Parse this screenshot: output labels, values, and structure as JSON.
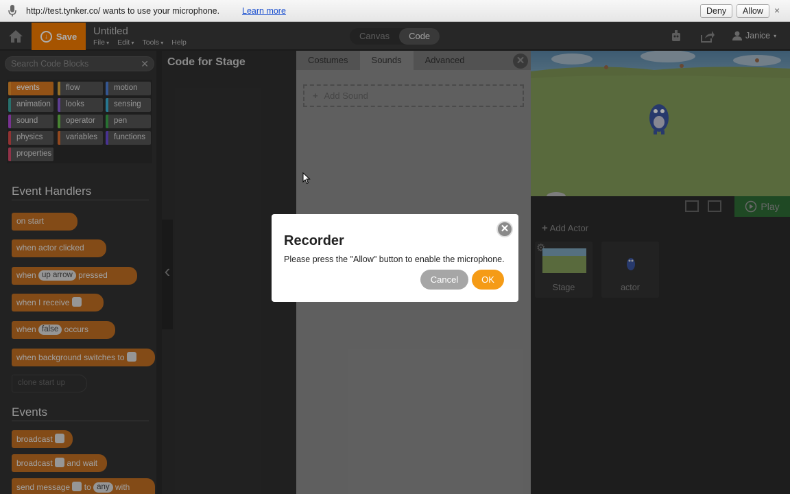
{
  "permission_bar": {
    "message": "http://test.tynker.co/ wants to use your microphone.",
    "learn_more": "Learn more",
    "deny": "Deny",
    "allow": "Allow",
    "close": "×"
  },
  "toolbar": {
    "save_label": "Save",
    "project_title": "Untitled",
    "menus": [
      "File",
      "Edit",
      "Tools",
      "Help"
    ],
    "modes": [
      "Canvas",
      "Code"
    ],
    "active_mode": "Code",
    "user": "Janice"
  },
  "palette": {
    "search_placeholder": "Search Code Blocks",
    "categories": [
      {
        "label": "events",
        "color": "#e8912f",
        "selected": true
      },
      {
        "label": "flow",
        "color": "#d9a43b"
      },
      {
        "label": "motion",
        "color": "#4d7fd6"
      },
      {
        "label": "animation",
        "color": "#3aa6a0"
      },
      {
        "label": "looks",
        "color": "#8a5ad6"
      },
      {
        "label": "sensing",
        "color": "#3ab0d6"
      },
      {
        "label": "sound",
        "color": "#b24bd6"
      },
      {
        "label": "operator",
        "color": "#6ac24b"
      },
      {
        "label": "pen",
        "color": "#3aa64b"
      },
      {
        "label": "physics",
        "color": "#d64b4b"
      },
      {
        "label": "variables",
        "color": "#d66a2f"
      },
      {
        "label": "functions",
        "color": "#6a4bd6"
      },
      {
        "label": "properties",
        "color": "#d64b6a"
      }
    ],
    "event_handlers_heading": "Event Handlers",
    "event_handlers": {
      "on_start": "on start",
      "actor_clicked": "when actor clicked",
      "key_when": "when",
      "key_slot": "up arrow",
      "key_pressed": "pressed",
      "receive": "when I receive",
      "occurs_when": "when",
      "occurs_slot": "false",
      "occurs_label": "occurs",
      "background": "when background switches to"
    },
    "ghost_block": "clone start up",
    "events_heading": "Events",
    "events": {
      "broadcast": "broadcast",
      "broadcast_wait_a": "broadcast",
      "broadcast_wait_b": "and wait",
      "send_a": "send message",
      "send_b": "to",
      "send_slot": "any",
      "send_c": "with"
    }
  },
  "code_area": {
    "heading": "Code for Stage"
  },
  "sounds_panel": {
    "tabs": [
      "Costumes",
      "Sounds",
      "Advanced"
    ],
    "active_tab": "Sounds",
    "add_sound": "Add Sound"
  },
  "stage": {
    "play_label": "Play"
  },
  "actors": {
    "add_actor": "Add Actor",
    "items": [
      {
        "label": "Stage"
      },
      {
        "label": "actor"
      }
    ]
  },
  "dialog": {
    "title": "Recorder",
    "message": "Please press the \"Allow\" button to enable the microphone.",
    "cancel": "Cancel",
    "ok": "OK"
  }
}
